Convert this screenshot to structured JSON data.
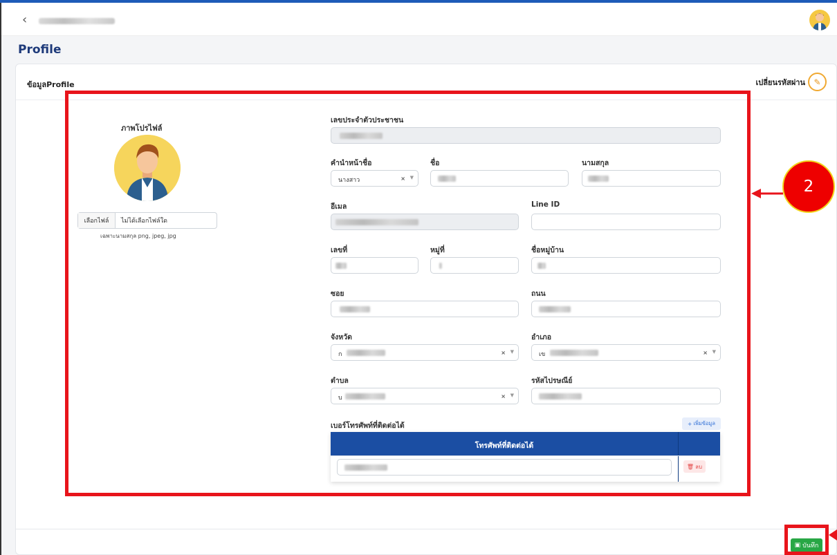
{
  "page": {
    "title": "Profile"
  },
  "card": {
    "title": "ข้อมูลProfile",
    "change_password_label": "เปลี่ยนรหัสผ่าน"
  },
  "profile_photo": {
    "label": "ภาพโปรไฟล์",
    "choose_file_button": "เลือกไฟล์",
    "no_file_text": "ไม่ได้เลือกไฟล์ใด",
    "hint": "เฉพาะนามสกุล png, jpeg, jpg"
  },
  "form": {
    "id_card_label": "เลขประจำตัวประชาชน",
    "prefix_label": "คำนำหน้าชื่อ",
    "prefix_value": "นางสาว",
    "first_name_label": "ชื่อ",
    "last_name_label": "นามสกุล",
    "email_label": "อีเมล",
    "line_id_label": "Line ID",
    "house_no_label": "เลขที่",
    "moo_label": "หมู่ที่",
    "village_label": "ชื่อหมู่บ้าน",
    "soi_label": "ซอย",
    "road_label": "ถนน",
    "province_label": "จังหวัด",
    "province_value_prefix": "ก",
    "district_label": "อำเภอ",
    "district_value_prefix": "เข",
    "subdistrict_label": "ตำบล",
    "subdistrict_value_prefix": "บ",
    "postal_label": "รหัสไปรษณีย์"
  },
  "phones": {
    "section_label": "เบอร์โทรศัพท์ที่ติดต่อได้",
    "add_button": "เพิ่มข้อมูล",
    "column_header": "โทรศัพท์ที่ติดต่อได้",
    "delete_button": "ลบ"
  },
  "footer": {
    "save_button": "บันทึก"
  },
  "annotation": {
    "callout_number": "2"
  },
  "colors": {
    "accent": "#1b4ea3",
    "title": "#1e3a7a",
    "highlight": "#e8141b",
    "save": "#28a745"
  }
}
